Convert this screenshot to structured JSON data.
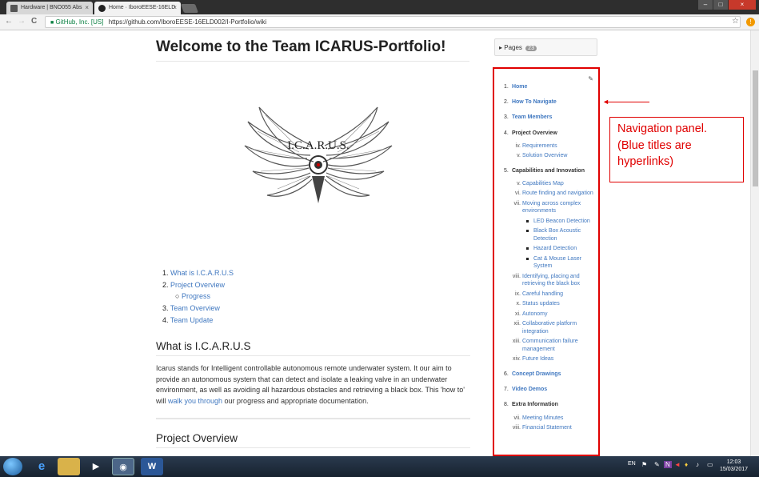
{
  "browser": {
    "tabs": [
      {
        "title": "Hardware | BNO055 Abs",
        "close": "×",
        "active": false
      },
      {
        "title": "Home · IboroEESE-16ELD",
        "close": "×",
        "active": true
      }
    ],
    "window_controls": [
      "–",
      "□",
      "×"
    ],
    "nav": {
      "back": "←",
      "forward": "→",
      "reload": "C"
    },
    "secure_label": "GitHub, Inc. [US]",
    "url": "https://github.com/IboroEESE-16ELD002/I-Portfolio/wiki",
    "star": "☆",
    "extension": "!"
  },
  "wiki": {
    "title": "Welcome to the Team ICARUS-Portfolio!",
    "logo_text": "I.C.A.R.U.S.",
    "toc": [
      {
        "num": "1.",
        "label": "What is I.C.A.R.U.S"
      },
      {
        "num": "2.",
        "label": "Project Overview"
      },
      {
        "num": "3.",
        "label": "Team Overview"
      },
      {
        "num": "4.",
        "label": "Team Update"
      }
    ],
    "toc_sub": {
      "bullet": "○",
      "label": "Progress"
    },
    "section1": {
      "heading": "What is I.C.A.R.U.S",
      "text1": "Icarus stands for Intelligent controllable autonomous remote underwater system. It our aim to provide an autonomous system that can detect and isolate a leaking valve in an underwater environment, as well as avoiding all hazardous obstacles and retrieving a black box. This 'how to' will ",
      "link": "walk you through",
      "text2": " our progress and appropriate documentation."
    },
    "section2": {
      "heading": "Project Overview"
    }
  },
  "sidebar": {
    "pages_label": "Pages",
    "pages_count": "23",
    "items": [
      {
        "num": "1.",
        "label": "Home",
        "link": true
      },
      {
        "num": "2.",
        "label": "How To Navigate",
        "link": true
      },
      {
        "num": "3.",
        "label": "Team Members",
        "link": true
      },
      {
        "num": "4.",
        "label": "Project Overview",
        "link": false
      },
      {
        "num": "5.",
        "label": "Capabilities and Innovation",
        "link": false
      },
      {
        "num": "6.",
        "label": "Concept Drawings",
        "link": true
      },
      {
        "num": "7.",
        "label": "Video Demos",
        "link": true
      },
      {
        "num": "8.",
        "label": "Extra Information",
        "link": false
      }
    ],
    "project_sub": [
      {
        "num": "iv.",
        "label": "Requirements"
      },
      {
        "num": "v.",
        "label": "Solution Overview"
      }
    ],
    "cap_sub": [
      {
        "num": "v.",
        "label": "Capabilities Map"
      },
      {
        "num": "vi.",
        "label": "Route finding and navigation"
      },
      {
        "num": "vii.",
        "label": "Moving across complex environments"
      }
    ],
    "cap_bullets": [
      "LED Beacon Detection",
      "Black Box Acoustic Detection",
      "Hazard Detection",
      "Cat & Mouse Laser System"
    ],
    "cap_sub2": [
      {
        "num": "viii.",
        "label": "Identifying, placing and retrieving the black box"
      },
      {
        "num": "ix.",
        "label": "Careful handling"
      },
      {
        "num": "x.",
        "label": "Status updates"
      },
      {
        "num": "xi.",
        "label": "Autonomy"
      },
      {
        "num": "xii.",
        "label": "Collaborative platform integration"
      },
      {
        "num": "xiii.",
        "label": "Communication failure management"
      },
      {
        "num": "xiv.",
        "label": "Future Ideas"
      }
    ],
    "extra_sub": [
      {
        "num": "vii.",
        "label": "Meeting Minutes"
      },
      {
        "num": "viii.",
        "label": "Financial Statement"
      }
    ]
  },
  "annotation": {
    "lines": [
      "Navigation panel.",
      "(Blue titles are",
      "hyperlinks)"
    ],
    "color": "#e00000"
  },
  "taskbar": {
    "lang": "EN",
    "time": "12:03",
    "date": "15/03/2017"
  }
}
